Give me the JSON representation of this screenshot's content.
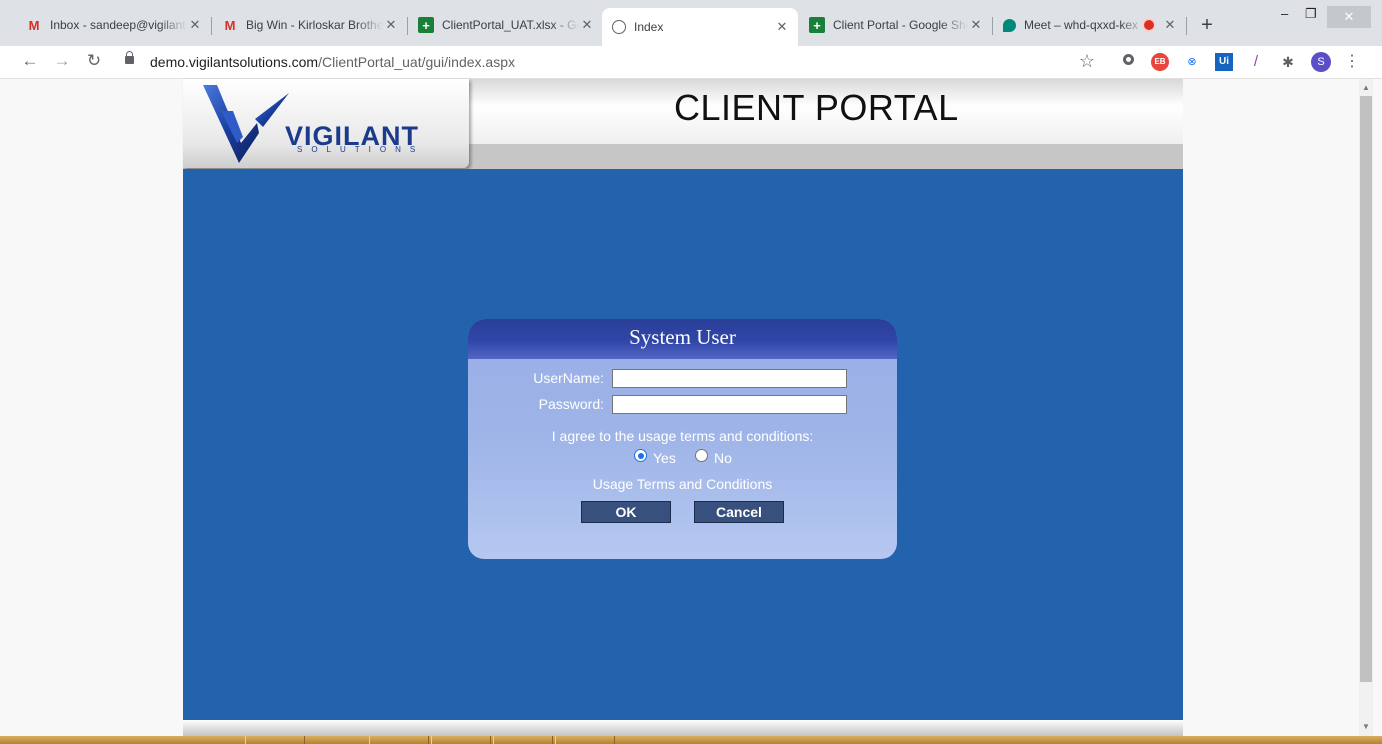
{
  "browser": {
    "tabs": [
      {
        "title": "Inbox - sandeep@vigilantsolutions.com",
        "icon": "gmail-icon",
        "close": "✕"
      },
      {
        "title": "Big Win - Kirloskar Brothers",
        "icon": "gmail-icon",
        "close": "✕"
      },
      {
        "title": "ClientPortal_UAT.xlsx - Google Sheets",
        "icon": "sheets-icon",
        "close": "✕"
      },
      {
        "title": "Index",
        "icon": "globe-icon",
        "close": "✕"
      },
      {
        "title": "Client Portal - Google Sheets",
        "icon": "sheets-icon",
        "close": "✕"
      },
      {
        "title": "Meet – whd-qxxd-kex",
        "icon": "meet-icon",
        "close": "✕"
      }
    ],
    "new_tab": "+",
    "window_controls": {
      "minimize": "–",
      "restore": "❐",
      "close": "✕"
    },
    "nav": {
      "back": "←",
      "forward": "→",
      "reload": "↻"
    },
    "url_host": "demo.vigilantsolutions.com",
    "url_path": "/ClientPortal_uat/gui/index.aspx",
    "bookmark": "☆",
    "profile_initial": "S",
    "menu": "⋮"
  },
  "page": {
    "logo_text": "VIGILANT",
    "logo_subtext": "SOLUTIONS",
    "portal_title": "CLIENT PORTAL"
  },
  "login": {
    "title": "System User",
    "username_label": "UserName:",
    "password_label": "Password:",
    "username_value": "",
    "password_value": "",
    "agree_text": "I agree to the usage terms and conditions:",
    "radio_yes": "Yes",
    "radio_no": "No",
    "selected_option": "Yes",
    "terms_link": "Usage Terms and Conditions",
    "ok_label": "OK",
    "cancel_label": "Cancel"
  },
  "colors": {
    "portal_blue": "#2362ad",
    "card_header": "#2a3f98",
    "button_bg": "#38507d",
    "logo_blue": "#1b3a8c"
  }
}
